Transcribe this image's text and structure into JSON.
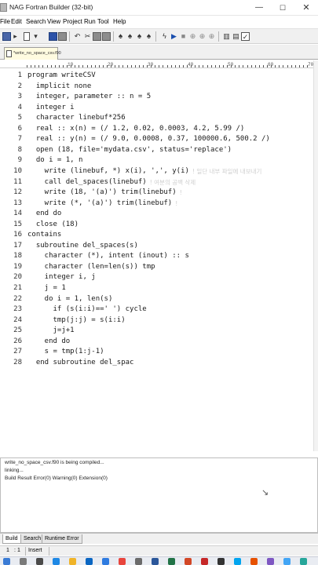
{
  "window": {
    "title": "NAG Fortran Builder (32-bit)",
    "controls": {
      "minimize": "—",
      "maximize": "☐",
      "close": "✕"
    }
  },
  "menu": [
    "File",
    "Edit",
    "Search",
    "View",
    "Project",
    "Run",
    "Tool",
    "Help"
  ],
  "toolbar": {
    "icons": [
      "new-file-icon",
      "open-folder-icon",
      "new-document-icon",
      "save-icon",
      "print-icon",
      "undo-icon",
      "cut-icon",
      "copy-icon",
      "paste-icon",
      "find-icon",
      "find-next-icon",
      "replace-icon",
      "go-to-icon",
      "compile-icon",
      "build-icon",
      "run-icon",
      "stop-icon",
      "debug-icon",
      "step-icon",
      "execute-icon",
      "tile-icon",
      "cascade-icon",
      "properties-icon"
    ]
  },
  "tabs": [
    {
      "label": "*write_no_space_csv.f90",
      "active": true
    }
  ],
  "ruler": {
    "marks": [
      "10",
      "20",
      "30",
      "40",
      "50",
      "60",
      "70"
    ]
  },
  "editor": {
    "lines": [
      {
        "num": "1",
        "text": "program writeCSV"
      },
      {
        "num": "2",
        "text": "  implicit none"
      },
      {
        "num": "3",
        "text": "  integer, parameter :: n = 5"
      },
      {
        "num": "4",
        "text": "  integer i"
      },
      {
        "num": "5",
        "text": "  character linebuf*256"
      },
      {
        "num": "6",
        "text": "  real :: x(n) = (/ 1.2, 0.02, 0.0003, 4.2, 5.99 /)"
      },
      {
        "num": "7",
        "text": "  real :: y(n) = (/ 9.0, 0.0008, 0.37, 100000.6, 500.2 /)"
      },
      {
        "num": "8",
        "text": "  open (18, file='mydata.csv', status='replace')"
      },
      {
        "num": "9",
        "text": "  do i = 1, n"
      },
      {
        "num": "10",
        "text": "    write (linebuf, *) x(i), ',', y(i)",
        "comment": "! 일단 내부 파일에 내보내기"
      },
      {
        "num": "11",
        "text": "    call del_spaces(linebuf)",
        "comment": "! 여분의 공백 삭제"
      },
      {
        "num": "12",
        "text": "    write (18, '(a)') trim(linebuf)",
        "comment": "!"
      },
      {
        "num": "13",
        "text": "    write (*, '(a)') trim(linebuf)",
        "comment": "!"
      },
      {
        "num": "14",
        "text": "  end do"
      },
      {
        "num": "15",
        "text": "  close (18)"
      },
      {
        "num": "16",
        "text": "contains"
      },
      {
        "num": "17",
        "text": "  subroutine del_spaces(s)"
      },
      {
        "num": "18",
        "text": "    character (*), intent (inout) :: s"
      },
      {
        "num": "19",
        "text": "    character (len=len(s)) tmp"
      },
      {
        "num": "20",
        "text": "    integer i, j"
      },
      {
        "num": "21",
        "text": "    j = 1"
      },
      {
        "num": "22",
        "text": "    do i = 1, len(s)"
      },
      {
        "num": "23",
        "text": "      if (s(i:i)==' ') cycle"
      },
      {
        "num": "24",
        "text": "      tmp(j:j) = s(i:i)"
      },
      {
        "num": "25",
        "text": "      j=j+1"
      },
      {
        "num": "26",
        "text": "    end do"
      },
      {
        "num": "27",
        "text": "    s = tmp(1:j-1)"
      },
      {
        "num": "28",
        "text": "  end subroutine del_spac"
      }
    ]
  },
  "output": {
    "lines": [
      "write_no_space_csv.f90 is being compiled...",
      "linking...",
      "Build Result Error(0) Warning(0) Extension(0)"
    ]
  },
  "bottom_tabs": [
    {
      "label": "Build",
      "active": true
    },
    {
      "label": "Search",
      "active": false
    },
    {
      "label": "Runtime Error",
      "active": false
    }
  ],
  "status": {
    "line": "1",
    "col": "1",
    "mode": "Insert"
  },
  "taskbar": {
    "icons": [
      {
        "name": "start-icon",
        "color": "#3a7bd5"
      },
      {
        "name": "search-icon",
        "color": "#7a7a7a"
      },
      {
        "name": "taskview-icon",
        "color": "#4a4a4a"
      },
      {
        "name": "edge-icon",
        "color": "#1e88e5"
      },
      {
        "name": "explorer-icon",
        "color": "#f0b429"
      },
      {
        "name": "store-icon",
        "color": "#0a66c2"
      },
      {
        "name": "mail-icon",
        "color": "#2f7be0"
      },
      {
        "name": "chrome-icon",
        "color": "#e8453c"
      },
      {
        "name": "settings-icon",
        "color": "#6b6b6b"
      },
      {
        "name": "word-icon",
        "color": "#2b579a"
      },
      {
        "name": "excel-icon",
        "color": "#217346"
      },
      {
        "name": "powerpoint-icon",
        "color": "#d24726"
      },
      {
        "name": "fortran-builder-icon",
        "color": "#c62828"
      },
      {
        "name": "terminal-icon",
        "color": "#333333"
      },
      {
        "name": "photos-icon",
        "color": "#00a4ef"
      },
      {
        "name": "media-icon",
        "color": "#e65100"
      },
      {
        "name": "notes-icon",
        "color": "#7e57c2"
      },
      {
        "name": "cloud-icon",
        "color": "#42a5f5"
      },
      {
        "name": "browser-icon",
        "color": "#26a69a"
      }
    ]
  }
}
